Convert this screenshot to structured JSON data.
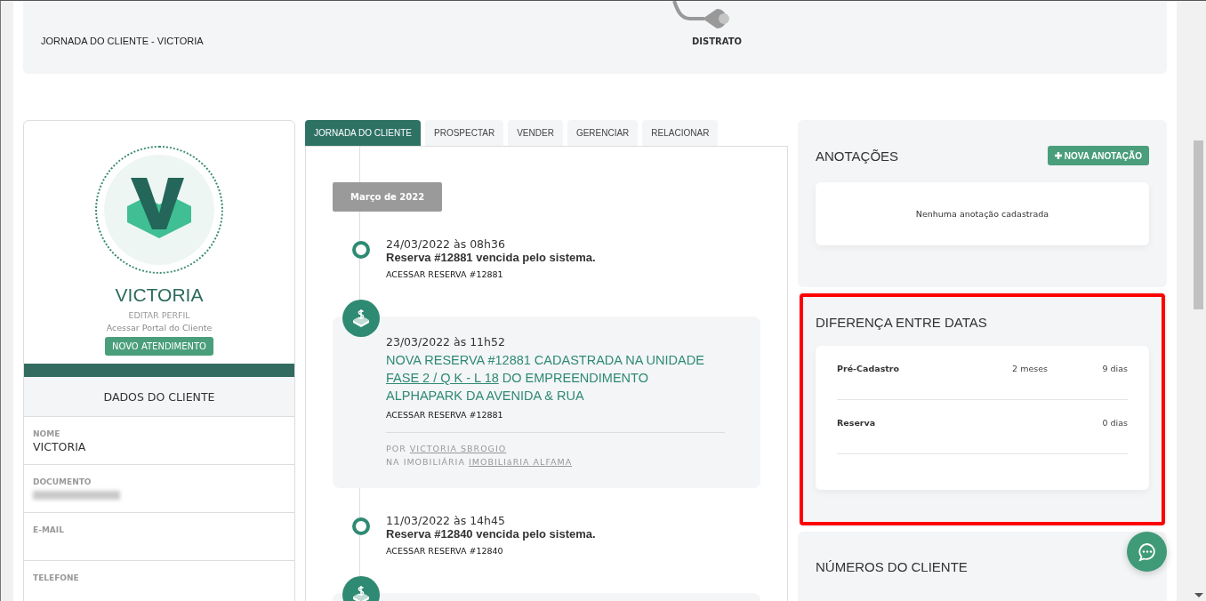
{
  "header": {
    "title": "JORNADA DO CLIENTE - VICTORIA",
    "journey_stage": "DISTRATO"
  },
  "profile": {
    "name": "VICTORIA",
    "edit_link": "EDITAR PERFIL",
    "portal_link": "Acessar Portal do Cliente",
    "action_button": "NOVO ATENDIMENTO"
  },
  "client_data": {
    "title": "DADOS DO CLIENTE",
    "fields": [
      {
        "label": "NOME",
        "value": "VICTORIA"
      },
      {
        "label": "DOCUMENTO",
        "redacted": true
      },
      {
        "label": "E-MAIL"
      },
      {
        "label": "TELEFONE"
      }
    ]
  },
  "tabs": [
    {
      "label": "JORNADA DO CLIENTE",
      "selected": true
    },
    {
      "label": "PROSPECTAR",
      "selected": false
    },
    {
      "label": "VENDER",
      "selected": false
    },
    {
      "label": "GERENCIAR",
      "selected": false
    },
    {
      "label": "RELACIONAR",
      "selected": false
    }
  ],
  "timeline": {
    "month": "Março de 2022",
    "events": [
      {
        "kind": "system",
        "datetime": "24/03/2022 às 08h36",
        "message": "Reserva #12881 vencida pelo sistema.",
        "link": "ACESSAR RESERVA #12881"
      },
      {
        "kind": "reservation",
        "datetime": "23/03/2022 às 11h52",
        "message_before": "NOVA RESERVA #12881 CADASTRADA NA UNIDADE",
        "unit_link": "FASE 2 / Q K - L 18",
        "message_after": "DO EMPREENDIMENTO ALPHAPARK DA AVENIDA & RUA",
        "link": "ACESSAR RESERVA #12881",
        "author_label": "POR",
        "author": "VICTORIA SBROGIO",
        "agency_label": "NA IMOBILIÁRIA",
        "agency": "IMOBILIáRIA ALFAMA"
      },
      {
        "kind": "system",
        "datetime": "11/03/2022 às 14h45",
        "message": "Reserva #12840 vencida pelo sistema.",
        "link": "ACESSAR RESERVA #12840"
      },
      {
        "kind": "reservation"
      }
    ]
  },
  "notes": {
    "title": "ANOTAÇÕES",
    "add_button": "NOVA ANOTAÇÃO",
    "empty_message": "Nenhuma anotação cadastrada"
  },
  "date_difference": {
    "title": "DIFERENÇA ENTRE DATAS",
    "highlighted": true,
    "rows": [
      {
        "label": "Pré-Cadastro",
        "months": "2 meses",
        "days": "9 dias"
      },
      {
        "label": "Reserva",
        "days": "0 dias"
      }
    ]
  },
  "client_numbers": {
    "title": "NÚMEROS DO CLIENTE"
  }
}
